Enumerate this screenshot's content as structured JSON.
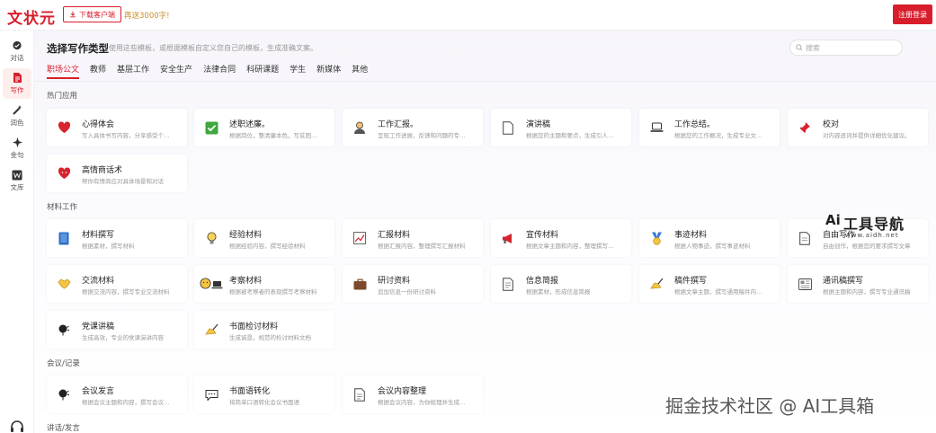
{
  "app": {
    "logo": "文状元",
    "download_label": "下载客户端",
    "promo": "再送3000字!",
    "login_label": "注册登录"
  },
  "sidebar": {
    "items": [
      {
        "label": "对话",
        "icon": "chat-icon"
      },
      {
        "label": "写作",
        "icon": "document-icon",
        "active": true
      },
      {
        "label": "润色",
        "icon": "magic-wand-icon"
      },
      {
        "label": "金句",
        "icon": "sparkle-icon"
      },
      {
        "label": "文库",
        "icon": "library-icon"
      }
    ]
  },
  "header": {
    "title": "选择写作类型",
    "subtitle": "使用这些模板，或根据模板自定义您自己的模板，生成准确文案。",
    "search_placeholder": "搜索"
  },
  "tabs": [
    "职场公文",
    "教师",
    "基层工作",
    "安全生产",
    "法律合同",
    "科研课题",
    "学生",
    "新媒体",
    "其他"
  ],
  "sections": [
    {
      "title": "热门应用"
    },
    {
      "title": "材料工作"
    },
    {
      "title": "会议/记录"
    },
    {
      "title": "讲话/发言"
    }
  ],
  "cards": {
    "hot": [
      {
        "title": "心得体会",
        "desc": "写入具体书写内容，分享感受个…",
        "icon": "heart-icon"
      },
      {
        "title": "述职述廉。",
        "desc": "根据岗位，整清廉本色，写贫困…",
        "icon": "checkbox-icon"
      },
      {
        "title": "工作汇报。",
        "desc": "呈现工作进展，反馈和问题的专…",
        "icon": "person-icon"
      },
      {
        "title": "演讲稿",
        "desc": "根据您的主题和要点，生成引人…",
        "icon": "page-icon"
      },
      {
        "title": "工作总结。",
        "desc": "根据您的工作概况，生成专业文…",
        "icon": "laptop-icon"
      },
      {
        "title": "校对",
        "desc": "对内容逐词并提供详细优化建议。",
        "icon": "pin-icon"
      },
      {
        "title": "高情商话术",
        "desc": "帮你有情商应对具体场景和对话",
        "icon": "heart-face-icon"
      }
    ],
    "materials": [
      {
        "title": "材料撰写",
        "desc": "根据素材，撰写材料",
        "icon": "book-icon"
      },
      {
        "title": "经验材料",
        "desc": "根据经验内容，撰写经验材料",
        "icon": "bulb-icon"
      },
      {
        "title": "汇报材料",
        "desc": "根据汇报内容，整理撰写汇报材料",
        "icon": "chart-icon"
      },
      {
        "title": "宣传材料",
        "desc": "根据文章主题和内容，整理撰写…",
        "icon": "megaphone-icon"
      },
      {
        "title": "事迹材料",
        "desc": "根据人物事迹，撰写事迹材料",
        "icon": "medal-icon"
      },
      {
        "title": "自由写作",
        "desc": "自由创作，根据您的要求撰写文章",
        "icon": "paper-icon"
      },
      {
        "title": "交流材料",
        "desc": "根据交流内容，撰写专业交流材料",
        "icon": "handshake-icon"
      },
      {
        "title": "考察材料",
        "desc": "根据被考察者的表现撰写考察材料",
        "icon": "face-laptop-icon"
      },
      {
        "title": "研讨资料",
        "desc": "追加信息一份研讨资料",
        "icon": "briefcase-icon"
      },
      {
        "title": "信息简报",
        "desc": "根据素材，形成信息简报",
        "icon": "note-icon"
      },
      {
        "title": "稿件撰写",
        "desc": "根据文章主题，撰写通用稿件内…",
        "icon": "writing-hand-icon"
      },
      {
        "title": "通讯稿撰写",
        "desc": "根据主题和内容，撰写专业通讯稿",
        "icon": "newspaper-icon"
      },
      {
        "title": "党课讲稿",
        "desc": "生成高效，专业的党课演讲内容",
        "icon": "speaker-icon"
      },
      {
        "title": "书面检讨材料",
        "desc": "生成诚恳，规范的检讨材料文档",
        "icon": "writing-hand-icon"
      }
    ],
    "meetings": [
      {
        "title": "会议发言",
        "desc": "根据会议主题和内容，撰写会议…",
        "icon": "speaker-icon"
      },
      {
        "title": "书面语转化",
        "desc": "将简单口语转化会议书面语",
        "icon": "speech-bubble-icon"
      },
      {
        "title": "会议内容整理",
        "desc": "根据会议内容，为你梳理并生成…",
        "icon": "page-icon"
      }
    ]
  },
  "watermarks": {
    "logo_ai": "Ai",
    "logo_text": "工具导航",
    "logo_url": "www.aidh.net",
    "bottom": "掘金技术社区 @ AI工具箱"
  },
  "colors": {
    "brand_red": "#d81e2c",
    "promo_gold": "#c8902a"
  }
}
